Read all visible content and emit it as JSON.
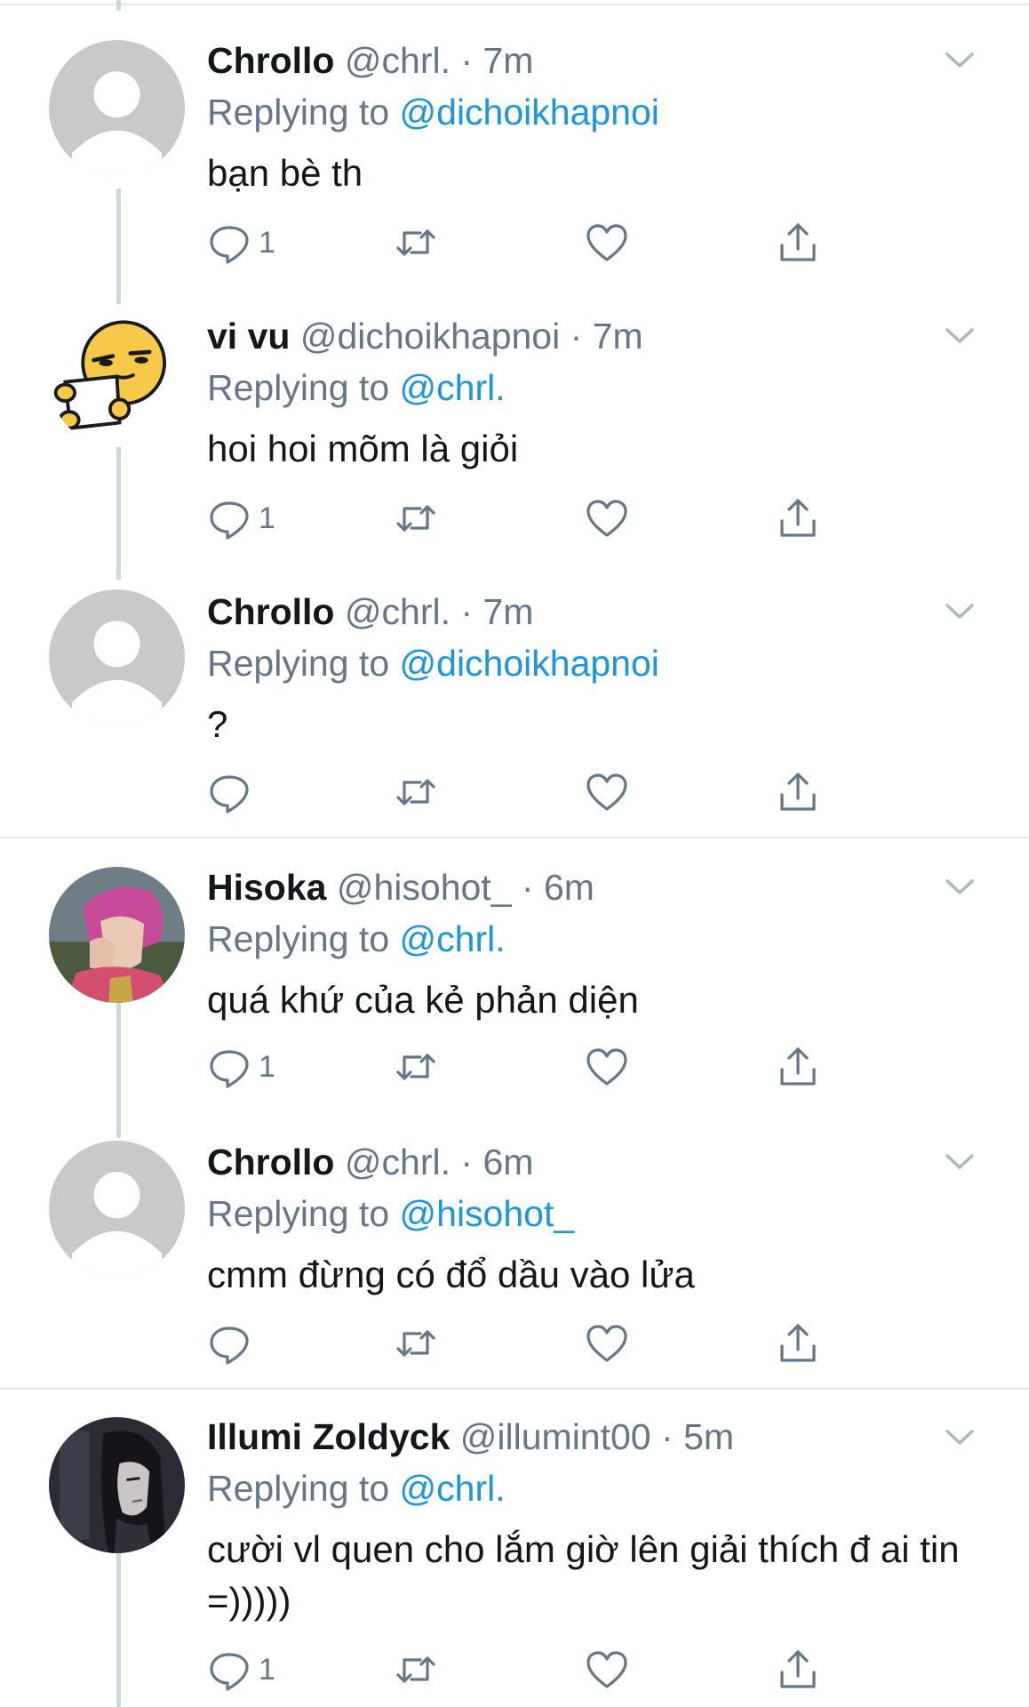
{
  "tweets": [
    {
      "name": "Chrollo",
      "handle": "@chrl.",
      "dot": "·",
      "time": "7m",
      "replying_prefix": "Replying to ",
      "replying_to": "@dichoikhapnoi",
      "text": "bạn bè th",
      "reply_count": "1",
      "avatar": "default-avatar"
    },
    {
      "name": "vi vu",
      "handle": "@dichoikhapnoi",
      "dot": "·",
      "time": "7m",
      "replying_prefix": "Replying to ",
      "replying_to": "@chrl.",
      "text": "hoi hoi mõm là giỏi",
      "reply_count": "1",
      "avatar": "emoji-reading-avatar"
    },
    {
      "name": "Chrollo",
      "handle": "@chrl.",
      "dot": "·",
      "time": "7m",
      "replying_prefix": "Replying to ",
      "replying_to": "@dichoikhapnoi",
      "text": "?",
      "reply_count": "",
      "avatar": "default-avatar"
    },
    {
      "name": "Hisoka",
      "handle": "@hisohot_",
      "dot": "·",
      "time": "6m",
      "replying_prefix": "Replying to ",
      "replying_to": "@chrl.",
      "text": "quá khứ của kẻ phản diện",
      "reply_count": "1",
      "avatar": "anime-pink-hair-avatar"
    },
    {
      "name": "Chrollo",
      "handle": "@chrl.",
      "dot": "·",
      "time": "6m",
      "replying_prefix": "Replying to ",
      "replying_to": "@hisohot_",
      "text": "cmm đừng có đổ dầu vào lửa",
      "reply_count": "",
      "avatar": "default-avatar"
    },
    {
      "name": "Illumi Zoldyck",
      "handle": "@illumint00",
      "dot": "·",
      "time": "5m",
      "replying_prefix": "Replying to ",
      "replying_to": "@chrl.",
      "text": "cười vl quen cho lắm giờ lên giải thích đ ai tin =)))))",
      "reply_count": "1",
      "avatar": "anime-dark-hair-avatar"
    }
  ],
  "icons": {
    "reply": "reply-icon",
    "retweet": "retweet-icon",
    "like": "heart-icon",
    "share": "share-icon",
    "menu": "chevron-down-icon"
  },
  "colors": {
    "link": "#1b95e0",
    "secondary": "#657786",
    "text": "#14171a",
    "divider": "#e1e8ed",
    "thread_line": "#cbd5de",
    "icon": "#657786"
  }
}
